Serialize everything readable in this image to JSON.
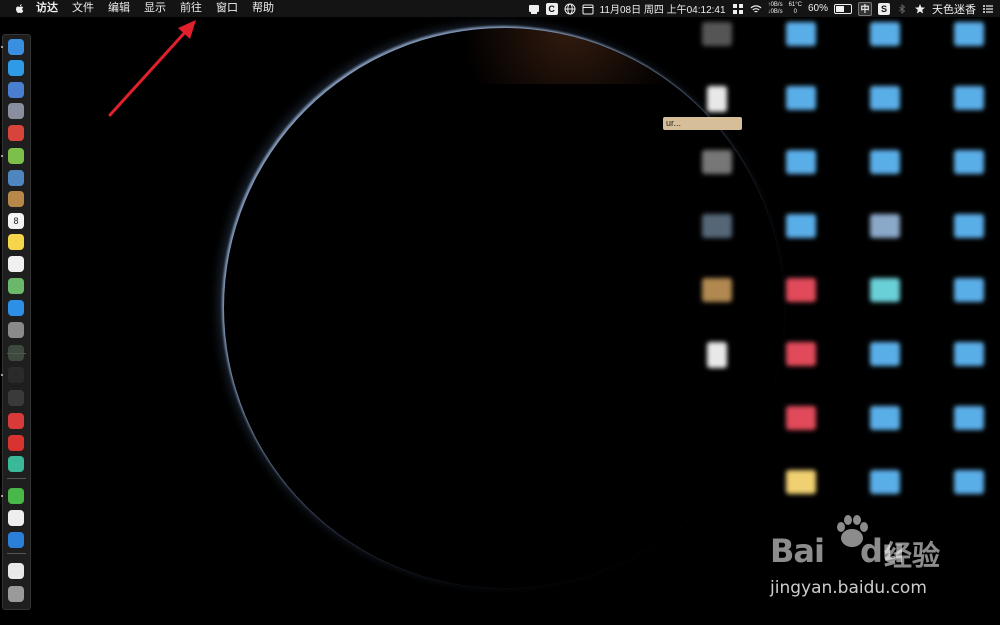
{
  "menubar": {
    "app_name": "访达",
    "items": [
      "文件",
      "编辑",
      "显示",
      "前往",
      "窗口",
      "帮助"
    ],
    "status": {
      "net_up": "↑0B/s",
      "net_down": "↓0B/s",
      "cpu_temp": "61°C",
      "cpu_value": "0",
      "datetime": "11月08日 周四 上午04:12:41",
      "battery_percent": "60%",
      "battery_level": 0.6,
      "input_method": "中",
      "user_name": "天色迷香",
      "c_icon_label": "C",
      "s_icon_label": "S"
    }
  },
  "annotation": {
    "color": "#e0202a"
  },
  "desktop": {
    "selected_file_label": "ur...",
    "icons": [
      {
        "label": "",
        "type": "app",
        "color": "#555555"
      },
      {
        "label": "",
        "type": "folder",
        "color": "#5aaee8"
      },
      {
        "label": "",
        "type": "folder",
        "color": "#5aaee8"
      },
      {
        "label": "",
        "type": "folder",
        "color": "#5aaee8"
      },
      {
        "label": "",
        "type": "doc",
        "color": "#e8e8e8"
      },
      {
        "label": "",
        "type": "folder",
        "color": "#5aaee8"
      },
      {
        "label": "",
        "type": "folder",
        "color": "#5aaee8"
      },
      {
        "label": "",
        "type": "folder",
        "color": "#5aaee8"
      },
      {
        "label": "",
        "type": "app",
        "color": "#777777"
      },
      {
        "label": "",
        "type": "folder",
        "color": "#5aaee8"
      },
      {
        "label": "",
        "type": "folder",
        "color": "#5aaee8"
      },
      {
        "label": "",
        "type": "folder",
        "color": "#5aaee8"
      },
      {
        "label": "",
        "type": "app",
        "color": "#556677"
      },
      {
        "label": "",
        "type": "folder",
        "color": "#5aaee8"
      },
      {
        "label": "",
        "type": "folder",
        "color": "#8aa8c8"
      },
      {
        "label": "",
        "type": "folder",
        "color": "#5aaee8"
      },
      {
        "label": "",
        "type": "app",
        "color": "#b08850"
      },
      {
        "label": "",
        "type": "folder",
        "color": "#e04a5a"
      },
      {
        "label": "",
        "type": "folder",
        "color": "#6ad0d8"
      },
      {
        "label": "",
        "type": "folder",
        "color": "#5aaee8"
      },
      {
        "label": "",
        "type": "doc",
        "color": "#e8e8e8"
      },
      {
        "label": "",
        "type": "folder",
        "color": "#e04a5a"
      },
      {
        "label": "",
        "type": "folder",
        "color": "#5aaee8"
      },
      {
        "label": "",
        "type": "folder",
        "color": "#5aaee8"
      },
      {
        "label": "",
        "type": "none",
        "color": "#000000"
      },
      {
        "label": "",
        "type": "folder",
        "color": "#e04a5a"
      },
      {
        "label": "",
        "type": "folder",
        "color": "#5aaee8"
      },
      {
        "label": "",
        "type": "folder",
        "color": "#5aaee8"
      },
      {
        "label": "",
        "type": "none",
        "color": "#000000"
      },
      {
        "label": "",
        "type": "folder",
        "color": "#f0d070"
      },
      {
        "label": "",
        "type": "folder",
        "color": "#5aaee8"
      },
      {
        "label": "",
        "type": "folder",
        "color": "#5aaee8"
      }
    ]
  },
  "dock": {
    "items": [
      {
        "icon": "finder-icon",
        "color": "#3b8fe0"
      },
      {
        "icon": "safari-icon",
        "color": "#2f9be8"
      },
      {
        "icon": "compass-icon",
        "color": "#4a7fd0"
      },
      {
        "icon": "launchpad-icon",
        "color": "#8a8fa0"
      },
      {
        "icon": "red-app-icon",
        "color": "#d9443a"
      },
      {
        "icon": "android-icon",
        "color": "#7cc04a"
      },
      {
        "icon": "preview-icon",
        "color": "#4f86c0"
      },
      {
        "icon": "notes-brown-icon",
        "color": "#b7884a"
      },
      {
        "icon": "calendar-icon",
        "color": "#f4f4f4"
      },
      {
        "icon": "notes-icon",
        "color": "#f5d64a"
      },
      {
        "icon": "reminders-icon",
        "color": "#f0f0f0"
      },
      {
        "icon": "maps-icon",
        "color": "#6bb86a"
      },
      {
        "icon": "app-store-icon",
        "color": "#2e8fe6"
      },
      {
        "icon": "system-preferences-icon",
        "color": "#8a8a8a"
      },
      {
        "icon": "activity-monitor-icon",
        "color": "#3d4a3d"
      },
      {
        "icon": "terminal-icon",
        "color": "#2a2a2a"
      },
      {
        "icon": "console-icon",
        "color": "#3a3a3a"
      },
      {
        "icon": "vivaldi-icon",
        "color": "#d83a3a"
      },
      {
        "icon": "netease-music-icon",
        "color": "#d8332e"
      },
      {
        "icon": "green-app-icon",
        "color": "#3ab89a"
      },
      {
        "icon": "wechat-icon",
        "color": "#48b848"
      },
      {
        "icon": "textedit-icon",
        "color": "#eeeeee"
      },
      {
        "icon": "blue-round-app-icon",
        "color": "#2a7fd8"
      },
      {
        "icon": "document-icon",
        "color": "#e8e8e8"
      },
      {
        "icon": "trash-icon",
        "color": "#9a9a9a"
      }
    ]
  },
  "watermark": {
    "logo_text": "Bai",
    "logo_suffix": "du",
    "cn_text": "经验",
    "url": "jingyan.baidu.com"
  }
}
